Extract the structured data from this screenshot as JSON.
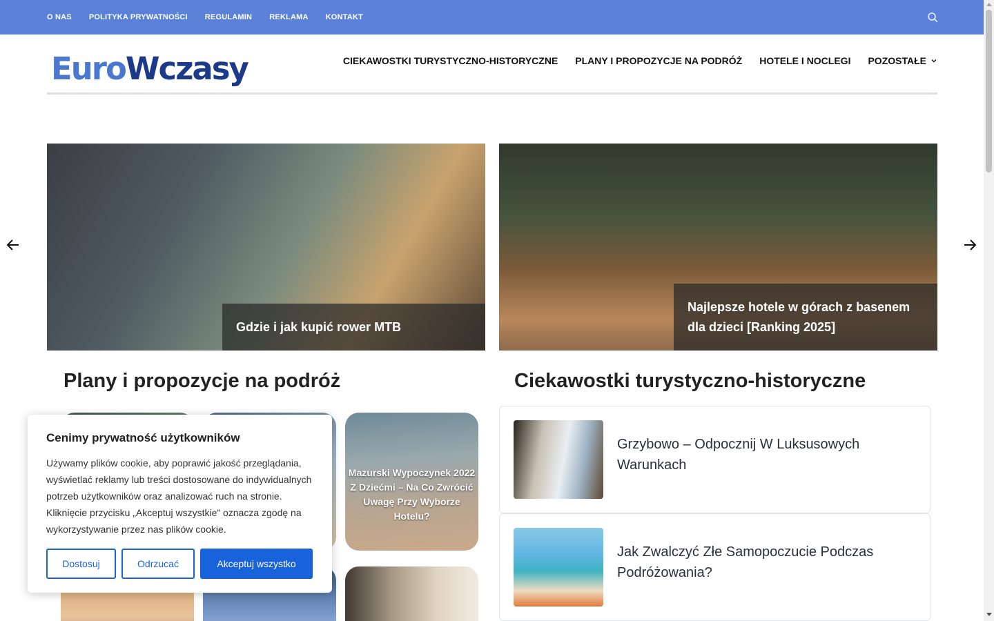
{
  "topbar": {
    "links": [
      "O NAS",
      "POLITYKA PRYWATNOŚCI",
      "REGULAMIN",
      "REKLAMA",
      "KONTAKT"
    ],
    "search_icon": "search-icon",
    "background": "#5b82d8"
  },
  "logo": {
    "part1": "Euro",
    "part2": "Wczasy"
  },
  "nav": {
    "items": [
      "CIEKAWOSTKI TURYSTYCZNO-HISTORYCZNE",
      "PLANY I PROPOZYCJE NA PODRÓŻ",
      "HOTELE I NOCLEGI",
      "POZOSTAŁE"
    ],
    "dropdown_icon": "chevron-down-icon"
  },
  "slider": {
    "slides": [
      {
        "title": "Gdzie i jak kupić rower MTB"
      },
      {
        "title": "Najlepsze hotele w górach z basenem dla dzieci [Ranking 2025]"
      }
    ],
    "prev_icon": "arrow-left-icon",
    "next_icon": "arrow-right-icon"
  },
  "sections": {
    "plans_title": "Plany i propozycje na podróż",
    "curiosities_title": "Ciekawostki turystyczno-historyczne"
  },
  "plan_cards": [
    {
      "title": ""
    },
    {
      "title": ""
    },
    {
      "title": "Mazurski Wypoczynek 2022 Z Dziećmi – Na Co Zwrócić Uwagę Przy Wyborze Hotelu?"
    },
    {
      "title": ""
    },
    {
      "title": ""
    },
    {
      "title": ""
    }
  ],
  "curiosity_list": [
    {
      "title": "Grzybowo – Odpocznij W Luksusowych Warunkach"
    },
    {
      "title": "Jak Zwalczyć Złe Samopoczucie Podczas Podróżowania?"
    }
  ],
  "cookie": {
    "title": "Cenimy prywatność użytkowników",
    "text": "Używamy plików cookie, aby poprawić jakość przeglądania, wyświetlać reklamy lub treści dostosowane do indywidualnych potrzeb użytkowników oraz analizować ruch na stronie. Kliknięcie przycisku „Akceptuj wszystkie” oznacza zgodę na wykorzystywanie przez nas plików cookie.",
    "customize_label": "Dostosuj",
    "reject_label": "Odrzucać",
    "accept_label": "Akceptuj wszystko",
    "accent_color": "#1863dc"
  }
}
